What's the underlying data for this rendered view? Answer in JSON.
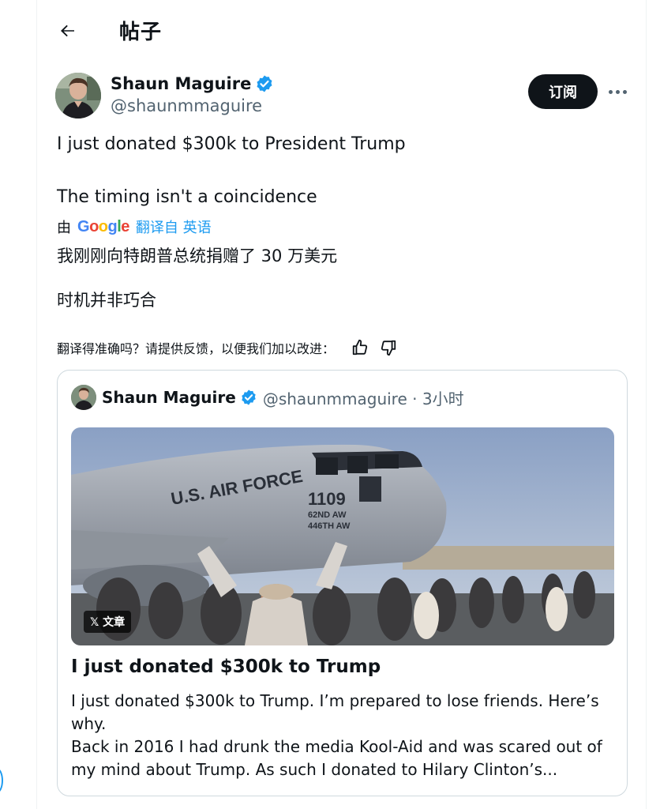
{
  "header": {
    "title": "帖子",
    "back_icon": "arrow-left-icon"
  },
  "post": {
    "author_name": "Shaun Maguire",
    "author_handle": "@shaunmmaguire",
    "subscribe_label": "订阅",
    "lines": [
      "I just donated $300k to President Trump",
      "The timing isn't a coincidence"
    ],
    "translation": {
      "by": "由",
      "provider": "Google",
      "link_text": "翻译自 英语",
      "lines": [
        "我刚刚向特朗普总统捐赠了 30 万美元",
        "时机并非巧合"
      ]
    },
    "feedback_prompt": "翻译得准确吗？请提供反馈，以便我们加以改进："
  },
  "quote": {
    "author_name": "Shaun Maguire",
    "handle_time": "@shaunmmaguire · 3小时",
    "image": {
      "tail_text": "U.S. AIR FORCE",
      "tail_number": "1109",
      "wing_line1": "62ND AW",
      "wing_line2": "446TH AW"
    },
    "badge_label": "𝕏 文章",
    "article_title": "I just donated $300k to Trump",
    "article_excerpt": [
      "I just donated $300k to Trump. I’m prepared to lose friends. Here’s why.",
      "Back in 2016 I had drunk the media Kool-Aid and was scared out of my mind about Trump. As such I donated to Hilary Clinton’s..."
    ]
  },
  "colors": {
    "text": "#0f1419",
    "secondary": "#536471",
    "link": "#1d9bf0",
    "verified": "#1d9bf0",
    "border": "#cfd9de"
  }
}
